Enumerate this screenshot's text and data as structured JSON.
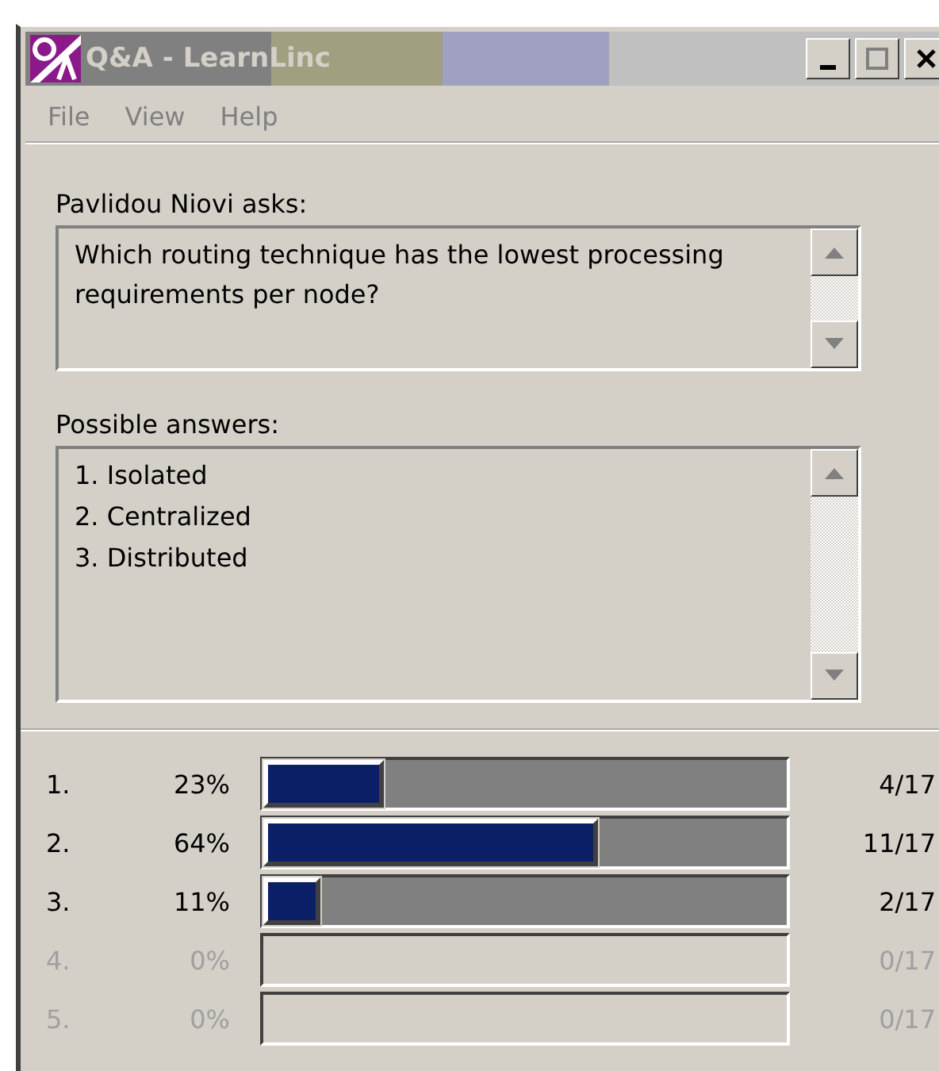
{
  "window": {
    "title": "Q&A - LearnLinc"
  },
  "menu": [
    "File",
    "View",
    "Help"
  ],
  "question": {
    "label": "Pavlidou Niovi asks:",
    "text": "Which routing technique has the lowest processing requirements per node?"
  },
  "answers": {
    "label": "Possible answers:",
    "items": [
      "1. Isolated",
      "2. Centralized",
      "3. Distributed"
    ]
  },
  "results": [
    {
      "number": "1.",
      "percent": "23%",
      "level": 0.23,
      "count": "4/17",
      "disabled": false
    },
    {
      "number": "2.",
      "percent": "64%",
      "level": 0.64,
      "count": "11/17",
      "disabled": false
    },
    {
      "number": "3.",
      "percent": "11%",
      "level": 0.11,
      "count": "2/17",
      "disabled": false
    },
    {
      "number": "4.",
      "percent": "0%",
      "count": "0/17",
      "disabled": true
    },
    {
      "number": "5.",
      "percent": "0%",
      "count": "0/17",
      "disabled": true
    }
  ]
}
